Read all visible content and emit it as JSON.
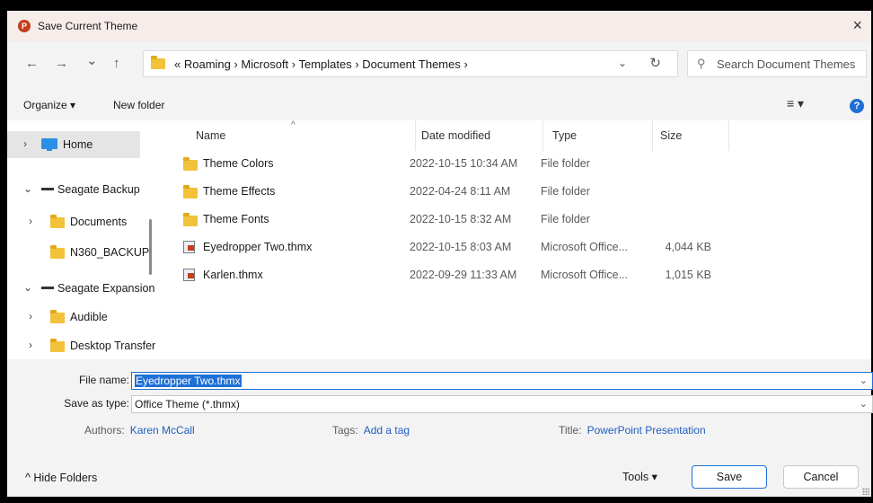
{
  "window": {
    "title": "Save Current Theme",
    "close_glyph": "×",
    "app_icon_letter": "P"
  },
  "nav": {
    "back_glyph": "←",
    "forward_glyph": "→",
    "recent_glyph": "⌄",
    "up_glyph": "↑",
    "breadcrumb": "« Roaming  ›  Microsoft  ›  Templates  ›  Document Themes  ›",
    "address_dropdown_glyph": "⌄",
    "refresh_glyph": "↻",
    "search_placeholder": "Search Document Themes",
    "search_glyph": "⚲"
  },
  "toolbar": {
    "organize_label": "Organize ▾",
    "new_folder_label": "New folder",
    "view_glyph": "≡ ▾",
    "help_glyph": "?"
  },
  "sidebar": {
    "items": [
      {
        "label": "Home",
        "chevron": "›",
        "icon": "pc-icon",
        "selected": true
      },
      {
        "label": "Seagate Backup",
        "chevron": "⌄",
        "icon": "drive-icon"
      },
      {
        "label": "Documents",
        "chevron": "›",
        "icon": "folder-icon"
      },
      {
        "label": "N360_BACKUP",
        "chevron": "",
        "icon": "folder-icon"
      },
      {
        "label": "Seagate Expansion",
        "chevron": "⌄",
        "icon": "drive-icon"
      },
      {
        "label": "Audible",
        "chevron": "›",
        "icon": "folder-icon"
      },
      {
        "label": "Desktop Transfer",
        "chevron": "›",
        "icon": "folder-icon"
      }
    ]
  },
  "columns": {
    "name": "Name",
    "date": "Date modified",
    "type": "Type",
    "size": "Size",
    "sort_glyph": "^"
  },
  "files": [
    {
      "name": "Theme Colors",
      "date": "2022-10-15 10:34 AM",
      "type": "File folder",
      "size": "",
      "icon": "folder-icon"
    },
    {
      "name": "Theme Effects",
      "date": "2022-04-24 8:11 AM",
      "type": "File folder",
      "size": "",
      "icon": "folder-icon"
    },
    {
      "name": "Theme Fonts",
      "date": "2022-10-15 8:32 AM",
      "type": "File folder",
      "size": "",
      "icon": "folder-icon"
    },
    {
      "name": "Eyedropper Two.thmx",
      "date": "2022-10-15 8:03 AM",
      "type": "Microsoft Office...",
      "size": "4,044 KB",
      "icon": "thmx-icon"
    },
    {
      "name": "Karlen.thmx",
      "date": "2022-09-29 11:33 AM",
      "type": "Microsoft Office...",
      "size": "1,015 KB",
      "icon": "thmx-icon"
    }
  ],
  "form": {
    "filename_label": "File name:",
    "filename_value": "Eyedropper Two.thmx",
    "savetype_label": "Save as type:",
    "savetype_value": "Office Theme (*.thmx)",
    "dropdown_glyph": "⌄",
    "authors_label": "Authors:",
    "authors_value": "Karen McCall",
    "tags_label": "Tags:",
    "tags_value": "Add a tag",
    "title_label": "Title:",
    "title_value": "PowerPoint Presentation"
  },
  "footer": {
    "hide_folders_label": "^  Hide Folders",
    "tools_label": "Tools  ▾",
    "save_label": "Save",
    "cancel_label": "Cancel"
  },
  "colors": {
    "accent": "#1f6fd6",
    "titlebar": "#f6ecea",
    "folder": "#f2c23a",
    "powerpoint": "#c43e1c"
  }
}
